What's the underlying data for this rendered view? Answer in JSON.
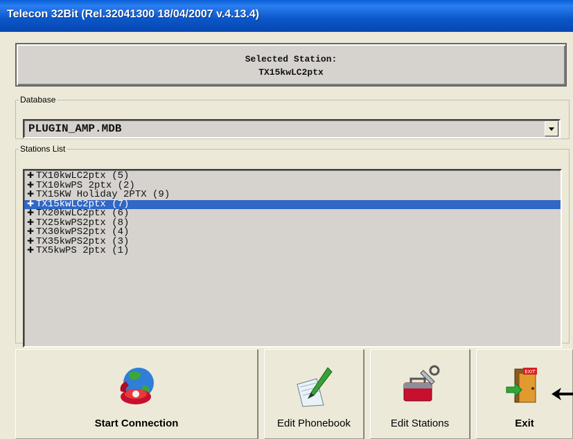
{
  "window": {
    "title": "Telecon 32Bit (Rel.32041300 18/04/2007 v.4.13.4)"
  },
  "selected_station": {
    "heading": "Selected Station:",
    "name": "TX15kwLC2ptx"
  },
  "database": {
    "legend": "Database",
    "value": "PLUGIN_AMP.MDB"
  },
  "stations": {
    "legend": "Stations List",
    "items": [
      "TX10kwLC2ptx (5)",
      "TX10kwPS 2ptx (2)",
      "TX15KW Holiday 2PTX (9)",
      "TX15kwLC2ptx (7)",
      "TX20kwLC2ptx (6)",
      "TX25kwPS2ptx (8)",
      "TX30kwPS2ptx (4)",
      "TX35kwPS2ptx (3)",
      "TX5kwPS 2ptx (1)"
    ],
    "selected_index": 3
  },
  "buttons": {
    "start": "Start Connection",
    "phonebook": "Edit Phonebook",
    "stations": "Edit Stations",
    "exit": "Exit"
  },
  "icons": {
    "start": "globe-phone-icon",
    "phonebook": "notebook-pen-icon",
    "stations": "toolbox-icon",
    "exit": "exit-door-icon",
    "plus": "expand-plus-icon",
    "pointer": "pointer-arrow-icon"
  },
  "colors": {
    "titlebar": "#0b56c9",
    "selection": "#3167c6",
    "window_bg": "#ece9d8"
  }
}
